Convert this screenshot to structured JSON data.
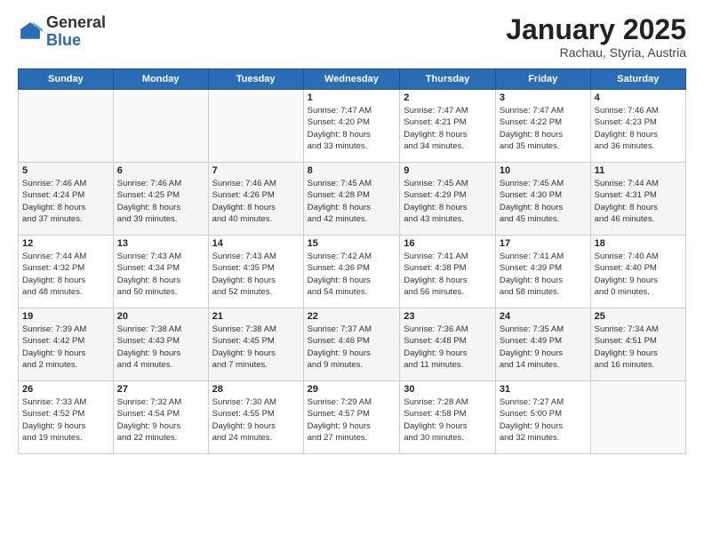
{
  "header": {
    "logo_general": "General",
    "logo_blue": "Blue",
    "title": "January 2025",
    "subtitle": "Rachau, Styria, Austria"
  },
  "weekdays": [
    "Sunday",
    "Monday",
    "Tuesday",
    "Wednesday",
    "Thursday",
    "Friday",
    "Saturday"
  ],
  "weeks": [
    [
      {
        "day": "",
        "info": ""
      },
      {
        "day": "",
        "info": ""
      },
      {
        "day": "",
        "info": ""
      },
      {
        "day": "1",
        "info": "Sunrise: 7:47 AM\nSunset: 4:20 PM\nDaylight: 8 hours\nand 33 minutes."
      },
      {
        "day": "2",
        "info": "Sunrise: 7:47 AM\nSunset: 4:21 PM\nDaylight: 8 hours\nand 34 minutes."
      },
      {
        "day": "3",
        "info": "Sunrise: 7:47 AM\nSunset: 4:22 PM\nDaylight: 8 hours\nand 35 minutes."
      },
      {
        "day": "4",
        "info": "Sunrise: 7:46 AM\nSunset: 4:23 PM\nDaylight: 8 hours\nand 36 minutes."
      }
    ],
    [
      {
        "day": "5",
        "info": "Sunrise: 7:46 AM\nSunset: 4:24 PM\nDaylight: 8 hours\nand 37 minutes."
      },
      {
        "day": "6",
        "info": "Sunrise: 7:46 AM\nSunset: 4:25 PM\nDaylight: 8 hours\nand 39 minutes."
      },
      {
        "day": "7",
        "info": "Sunrise: 7:46 AM\nSunset: 4:26 PM\nDaylight: 8 hours\nand 40 minutes."
      },
      {
        "day": "8",
        "info": "Sunrise: 7:45 AM\nSunset: 4:28 PM\nDaylight: 8 hours\nand 42 minutes."
      },
      {
        "day": "9",
        "info": "Sunrise: 7:45 AM\nSunset: 4:29 PM\nDaylight: 8 hours\nand 43 minutes."
      },
      {
        "day": "10",
        "info": "Sunrise: 7:45 AM\nSunset: 4:30 PM\nDaylight: 8 hours\nand 45 minutes."
      },
      {
        "day": "11",
        "info": "Sunrise: 7:44 AM\nSunset: 4:31 PM\nDaylight: 8 hours\nand 46 minutes."
      }
    ],
    [
      {
        "day": "12",
        "info": "Sunrise: 7:44 AM\nSunset: 4:32 PM\nDaylight: 8 hours\nand 48 minutes."
      },
      {
        "day": "13",
        "info": "Sunrise: 7:43 AM\nSunset: 4:34 PM\nDaylight: 8 hours\nand 50 minutes."
      },
      {
        "day": "14",
        "info": "Sunrise: 7:43 AM\nSunset: 4:35 PM\nDaylight: 8 hours\nand 52 minutes."
      },
      {
        "day": "15",
        "info": "Sunrise: 7:42 AM\nSunset: 4:36 PM\nDaylight: 8 hours\nand 54 minutes."
      },
      {
        "day": "16",
        "info": "Sunrise: 7:41 AM\nSunset: 4:38 PM\nDaylight: 8 hours\nand 56 minutes."
      },
      {
        "day": "17",
        "info": "Sunrise: 7:41 AM\nSunset: 4:39 PM\nDaylight: 8 hours\nand 58 minutes."
      },
      {
        "day": "18",
        "info": "Sunrise: 7:40 AM\nSunset: 4:40 PM\nDaylight: 9 hours\nand 0 minutes."
      }
    ],
    [
      {
        "day": "19",
        "info": "Sunrise: 7:39 AM\nSunset: 4:42 PM\nDaylight: 9 hours\nand 2 minutes."
      },
      {
        "day": "20",
        "info": "Sunrise: 7:38 AM\nSunset: 4:43 PM\nDaylight: 9 hours\nand 4 minutes."
      },
      {
        "day": "21",
        "info": "Sunrise: 7:38 AM\nSunset: 4:45 PM\nDaylight: 9 hours\nand 7 minutes."
      },
      {
        "day": "22",
        "info": "Sunrise: 7:37 AM\nSunset: 4:46 PM\nDaylight: 9 hours\nand 9 minutes."
      },
      {
        "day": "23",
        "info": "Sunrise: 7:36 AM\nSunset: 4:48 PM\nDaylight: 9 hours\nand 11 minutes."
      },
      {
        "day": "24",
        "info": "Sunrise: 7:35 AM\nSunset: 4:49 PM\nDaylight: 9 hours\nand 14 minutes."
      },
      {
        "day": "25",
        "info": "Sunrise: 7:34 AM\nSunset: 4:51 PM\nDaylight: 9 hours\nand 16 minutes."
      }
    ],
    [
      {
        "day": "26",
        "info": "Sunrise: 7:33 AM\nSunset: 4:52 PM\nDaylight: 9 hours\nand 19 minutes."
      },
      {
        "day": "27",
        "info": "Sunrise: 7:32 AM\nSunset: 4:54 PM\nDaylight: 9 hours\nand 22 minutes."
      },
      {
        "day": "28",
        "info": "Sunrise: 7:30 AM\nSunset: 4:55 PM\nDaylight: 9 hours\nand 24 minutes."
      },
      {
        "day": "29",
        "info": "Sunrise: 7:29 AM\nSunset: 4:57 PM\nDaylight: 9 hours\nand 27 minutes."
      },
      {
        "day": "30",
        "info": "Sunrise: 7:28 AM\nSunset: 4:58 PM\nDaylight: 9 hours\nand 30 minutes."
      },
      {
        "day": "31",
        "info": "Sunrise: 7:27 AM\nSunset: 5:00 PM\nDaylight: 9 hours\nand 32 minutes."
      },
      {
        "day": "",
        "info": ""
      }
    ]
  ]
}
